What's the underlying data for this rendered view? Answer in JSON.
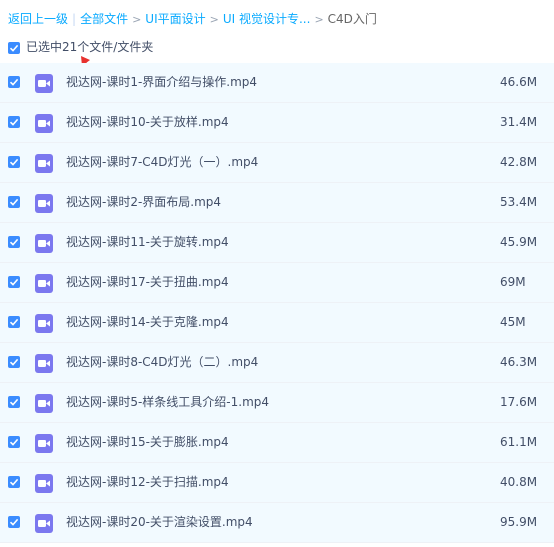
{
  "breadcrumb": {
    "back": "返回上一级",
    "all_files": "全部文件",
    "items": [
      "UI平面设计",
      "UI 视觉设计专..."
    ],
    "current": "C4D入门"
  },
  "selection": {
    "label": "已选中21个文件/文件夹",
    "checked": true
  },
  "colors": {
    "accent": "#3b8cff",
    "link": "#09aaff",
    "row_selected_bg": "#f2faff",
    "video_icon": "#7b78ef",
    "annotation_arrow": "#e8312e"
  },
  "files": [
    {
      "name": "视达网-课时1-界面介绍与操作.mp4",
      "size": "46.6M",
      "checked": true,
      "icon": "video-file-icon"
    },
    {
      "name": "视达网-课时10-关于放样.mp4",
      "size": "31.4M",
      "checked": true,
      "icon": "video-file-icon"
    },
    {
      "name": "视达网-课时7-C4D灯光（一）.mp4",
      "size": "42.8M",
      "checked": true,
      "icon": "video-file-icon"
    },
    {
      "name": "视达网-课时2-界面布局.mp4",
      "size": "53.4M",
      "checked": true,
      "icon": "video-file-icon"
    },
    {
      "name": "视达网-课时11-关于旋转.mp4",
      "size": "45.9M",
      "checked": true,
      "icon": "video-file-icon"
    },
    {
      "name": "视达网-课时17-关于扭曲.mp4",
      "size": "69M",
      "checked": true,
      "icon": "video-file-icon"
    },
    {
      "name": "视达网-课时14-关于克隆.mp4",
      "size": "45M",
      "checked": true,
      "icon": "video-file-icon"
    },
    {
      "name": "视达网-课时8-C4D灯光（二）.mp4",
      "size": "46.3M",
      "checked": true,
      "icon": "video-file-icon"
    },
    {
      "name": "视达网-课时5-样条线工具介绍-1.mp4",
      "size": "17.6M",
      "checked": true,
      "icon": "video-file-icon"
    },
    {
      "name": "视达网-课时15-关于膨胀.mp4",
      "size": "61.1M",
      "checked": true,
      "icon": "video-file-icon"
    },
    {
      "name": "视达网-课时12-关于扫描.mp4",
      "size": "40.8M",
      "checked": true,
      "icon": "video-file-icon"
    },
    {
      "name": "视达网-课时20-关于渲染设置.mp4",
      "size": "95.9M",
      "checked": true,
      "icon": "video-file-icon"
    }
  ]
}
